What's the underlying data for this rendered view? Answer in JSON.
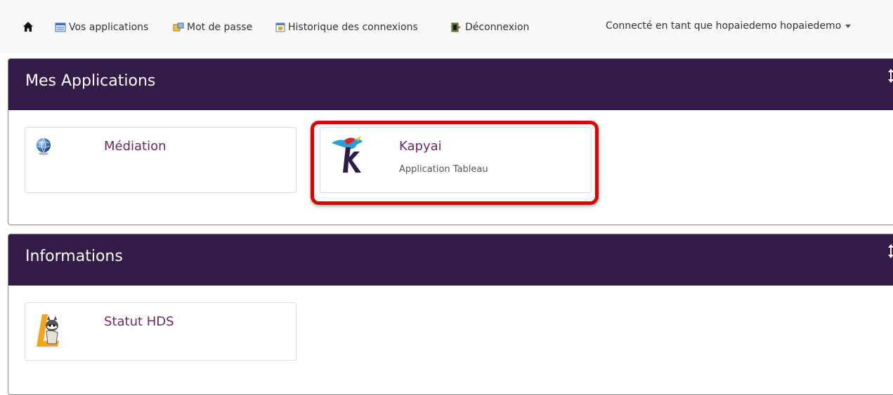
{
  "nav": {
    "items": [
      {
        "label": "Vos applications",
        "icon": "applications-icon"
      },
      {
        "label": "Mot de passe",
        "icon": "password-icon"
      },
      {
        "label": "Historique des connexions",
        "icon": "calendar-icon"
      },
      {
        "label": "Déconnexion",
        "icon": "logout-icon"
      }
    ],
    "user": "Connecté en tant que hopaiedemo hopaiedemo"
  },
  "panels": [
    {
      "title": "Mes Applications",
      "apps": [
        {
          "name": "Médiation",
          "desc": "",
          "icon": "globe-icon"
        },
        {
          "name": "Kapyai",
          "desc": "Application Tableau",
          "icon": "kapyai-logo-icon"
        }
      ]
    },
    {
      "title": "Informations",
      "apps": [
        {
          "name": "Statut HDS",
          "desc": "",
          "icon": "hds-status-icon"
        }
      ]
    }
  ],
  "colors": {
    "panel_header": "#331c47",
    "app_name": "#6b2a66",
    "highlight": "#e00000",
    "nav_bg": "#f8f8f8"
  }
}
